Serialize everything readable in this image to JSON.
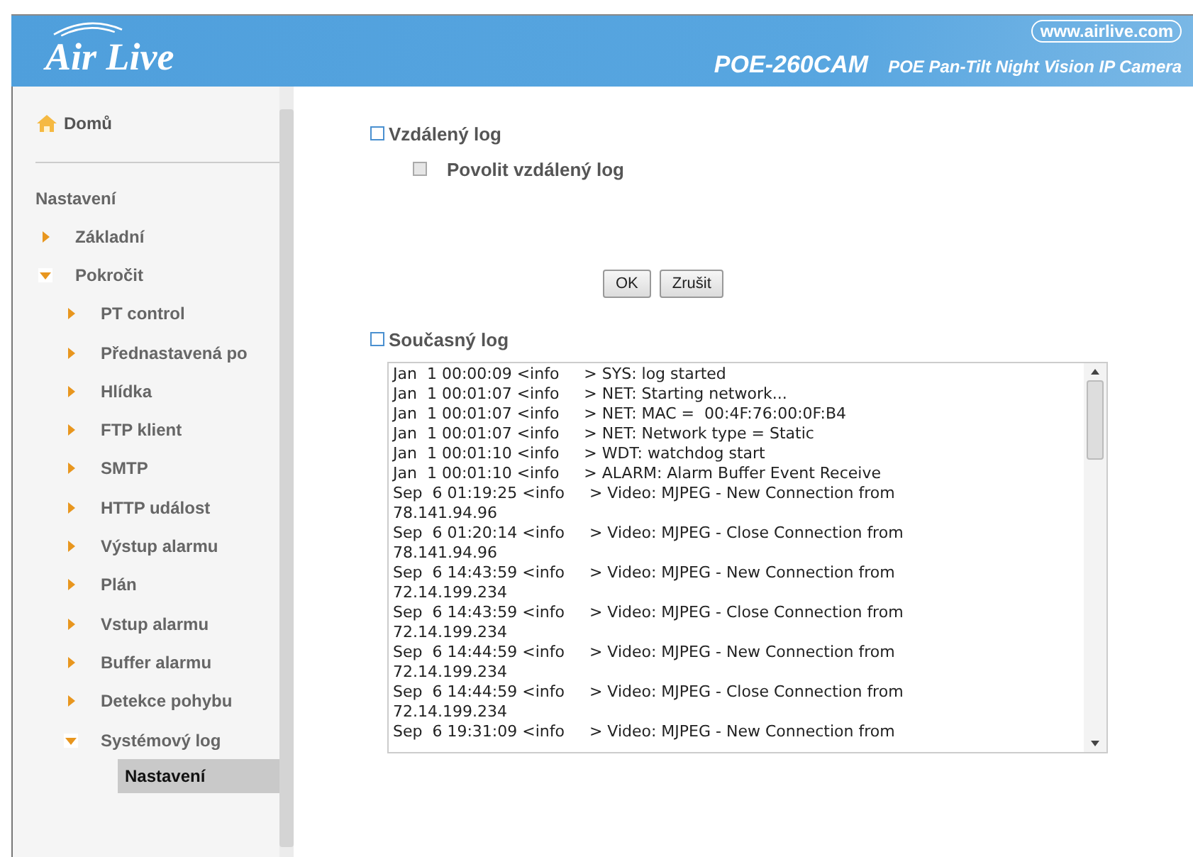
{
  "header": {
    "brand": "Air Live",
    "url": "www.airlive.com",
    "model": "POE-260CAM",
    "description": "POE Pan-Tilt Night Vision IP Camera"
  },
  "sidebar": {
    "home": "Domů",
    "heading": "Nastavení",
    "items": [
      {
        "label": "Základní",
        "expanded": false
      },
      {
        "label": "Pokročit",
        "expanded": true,
        "children": [
          {
            "label": "PT control",
            "expanded": false
          },
          {
            "label": "Přednastavená po",
            "expanded": false
          },
          {
            "label": "Hlídka",
            "expanded": false
          },
          {
            "label": "FTP klient",
            "expanded": false
          },
          {
            "label": "SMTP",
            "expanded": false
          },
          {
            "label": "HTTP událost",
            "expanded": false
          },
          {
            "label": "Výstup alarmu",
            "expanded": false
          },
          {
            "label": "Plán",
            "expanded": false
          },
          {
            "label": "Vstup alarmu",
            "expanded": false
          },
          {
            "label": "Buffer alarmu",
            "expanded": false
          },
          {
            "label": "Detekce pohybu",
            "expanded": false
          },
          {
            "label": "Systémový log",
            "expanded": true,
            "children": [
              {
                "label": "Nastavení",
                "selected": true
              }
            ]
          }
        ]
      }
    ]
  },
  "remote_log": {
    "title": "Vzdálený log",
    "checkbox": {
      "label": "Povolit vzdálený log",
      "checked": false
    }
  },
  "buttons": [
    "OK",
    "Zrušit"
  ],
  "current_log": {
    "title": "Současný log",
    "lines": [
      "Jan  1 00:00:09 <info     > SYS: log started",
      "Jan  1 00:01:07 <info     > NET: Starting network...",
      "Jan  1 00:01:07 <info     > NET: MAC =  00:4F:76:00:0F:B4",
      "Jan  1 00:01:07 <info     > NET: Network type = Static",
      "Jan  1 00:01:10 <info     > WDT: watchdog start",
      "Jan  1 00:01:10 <info     > ALARM: Alarm Buffer Event Receive",
      "Sep  6 01:19:25 <info     > Video: MJPEG - New Connection from",
      "78.141.94.96",
      "Sep  6 01:20:14 <info     > Video: MJPEG - Close Connection from",
      "78.141.94.96",
      "Sep  6 14:43:59 <info     > Video: MJPEG - New Connection from",
      "72.14.199.234",
      "Sep  6 14:43:59 <info     > Video: MJPEG - Close Connection from",
      "72.14.199.234",
      "Sep  6 14:44:59 <info     > Video: MJPEG - New Connection from",
      "72.14.199.234",
      "Sep  6 14:44:59 <info     > Video: MJPEG - Close Connection from",
      "72.14.199.234",
      "Sep  6 19:31:09 <info     > Video: MJPEG - New Connection from"
    ]
  }
}
